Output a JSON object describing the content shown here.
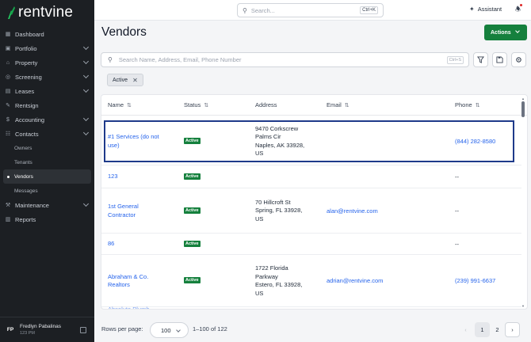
{
  "brand": {
    "name": "rentvine",
    "accent": "#15803d"
  },
  "topbar": {
    "search_placeholder": "Search...",
    "search_shortcut": "Ctrl+K",
    "assistant_label": "Assistant"
  },
  "sidebar": {
    "items": [
      {
        "label": "Dashboard",
        "icon": "dashboard-icon"
      },
      {
        "label": "Portfolio",
        "icon": "portfolio-icon",
        "expandable": true
      },
      {
        "label": "Property",
        "icon": "property-icon",
        "expandable": true
      },
      {
        "label": "Screening",
        "icon": "screening-icon",
        "expandable": true
      },
      {
        "label": "Leases",
        "icon": "leases-icon",
        "expandable": true
      },
      {
        "label": "Rentsign",
        "icon": "rentsign-icon"
      },
      {
        "label": "Accounting",
        "icon": "accounting-icon",
        "expandable": true
      },
      {
        "label": "Contacts",
        "icon": "contacts-icon",
        "expandable": true
      }
    ],
    "contacts_sub": [
      {
        "label": "Owners"
      },
      {
        "label": "Tenants"
      },
      {
        "label": "Vendors",
        "active": true
      },
      {
        "label": "Messages"
      }
    ],
    "items_after": [
      {
        "label": "Maintenance",
        "icon": "maintenance-icon",
        "expandable": true
      },
      {
        "label": "Reports",
        "icon": "reports-icon"
      }
    ],
    "user": {
      "initials": "FP",
      "name": "Fredlyn Pabalinas",
      "sub": "123 PM"
    }
  },
  "page": {
    "title": "Vendors",
    "actions_label": "Actions",
    "filter_placeholder": "Search Name, Address, Email, Phone Number",
    "filter_shortcut": "Ctrl+S",
    "active_chip": "Active"
  },
  "table": {
    "columns": [
      "Name",
      "Status",
      "Address",
      "Email",
      "Phone"
    ],
    "rows": [
      {
        "name": [
          "#1 Services (do not",
          "use)"
        ],
        "status": "Active",
        "address": [
          "9470 Corkscrew",
          "Palms Cir",
          "Naples, AK 33928,",
          "US"
        ],
        "email": "",
        "phone": "(844) 282-8580",
        "selected": true
      },
      {
        "name": [
          "123"
        ],
        "status": "Active",
        "address": [],
        "email": "",
        "phone": "--"
      },
      {
        "name": [
          "1st General",
          "Contractor"
        ],
        "status": "Active",
        "address": [
          "70 Hillcroft St",
          "Spring, FL 33928,",
          "US"
        ],
        "email": "alan@rentvine.com",
        "phone": "--"
      },
      {
        "name": [
          "86"
        ],
        "status": "Active",
        "address": [],
        "email": "",
        "phone": "--"
      },
      {
        "name": [
          "Abraham & Co.",
          "Realtors"
        ],
        "status": "Active",
        "address": [
          "1722 Florida",
          "Parkway",
          "Estero, FL 33928,",
          "US"
        ],
        "email": "adrian@rentvine.com",
        "phone": "(239) 991-6637"
      }
    ]
  },
  "footer": {
    "rows_per_page_label": "Rows per page:",
    "rows_per_page_value": "100",
    "range_text": "1–100 of 122",
    "pages": [
      "1",
      "2"
    ],
    "current_page": "1"
  }
}
